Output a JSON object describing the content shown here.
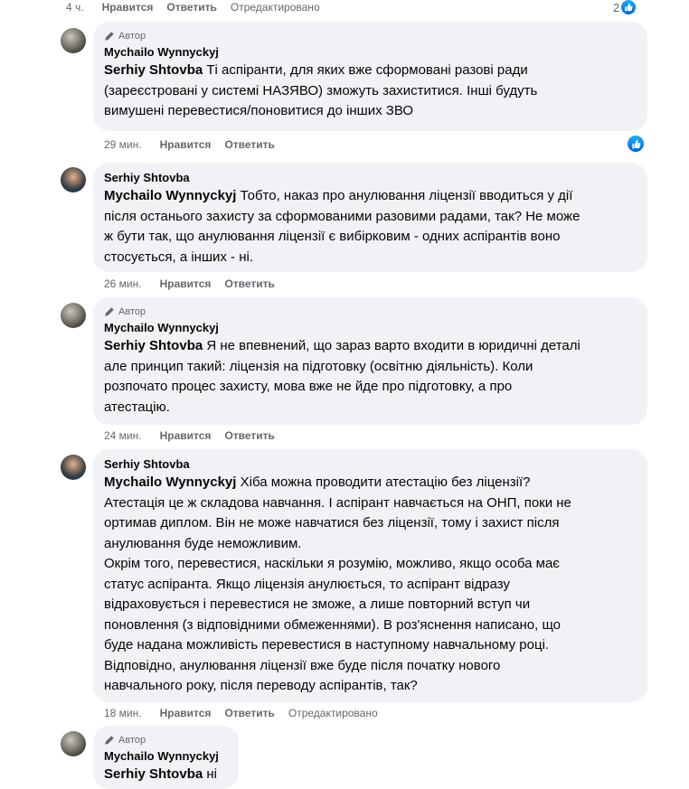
{
  "top_meta": {
    "time": "4 ч.",
    "like": "Нравится",
    "reply": "Ответить",
    "edited": "Отредактировано",
    "reactions": "2"
  },
  "comments": [
    {
      "badge": "Автор",
      "author": "Mychailo Wynnyckyj",
      "mention": "Serhiy Shtovba",
      "text": " Ті аспіранти, для яких вже сформовані разові ради\n(зареєстровані у системі НАЗЯВО) зможуть захиститися. Інші будуть\nвимушені перевестися/поновитися до інших ЗВО",
      "time": "29 мин.",
      "like": "Нравится",
      "reply": "Ответить"
    },
    {
      "author": "Serhiy Shtovba",
      "mention": "Mychailo Wynnyckyj",
      "text": " Тобто, наказ про анулювання ліцензії вводиться у дії\nпісля останього захисту за сформованими разовими радами, так? Не може\nж бути так, що анулювання ліцензії є вибірковим - одних аспірантів воно\nстосується, а інших - ні.",
      "time": "26 мин.",
      "like": "Нравится",
      "reply": "Ответить"
    },
    {
      "badge": "Автор",
      "author": "Mychailo Wynnyckyj",
      "mention": "Serhiy Shtovba",
      "text": " Я не впевнений, що зараз варто входити в юридичні деталі\nале принцип такий: ліцензія на підготовку (освітню діяльність). Коли\nрозпочато процес захисту, мова вже не йде про підготовку, а про\nатестацію.",
      "time": "24 мин.",
      "like": "Нравится",
      "reply": "Ответить"
    },
    {
      "author": "Serhiy Shtovba",
      "mention": "Mychailo Wynnyckyj",
      "text": " Хіба можна проводити атестацію без ліцензії?\nАтестація це ж складова навчання. І аспірант навчається на ОНП, поки не\nортимав диплом. Він не може навчатися без ліцензії, тому і захист після\nанулювання буде неможливим.\nОкрім того, перевестися, наскільки я розумію, можливо, якщо особа має\nстатус аспіранта. Якщо ліцензія анулюється, то аспірант відразу\nвідраховується і перевестися не зможе, а лише повторний вступ чи\nпоновлення (з відповідними обмеженнями). В роз'яснення написано, що\nбуде надана можливість перевестися в наступному навчальному році.\nВідповідно, анулювання ліцензії вже буде після початку нового\nнавчального року, після переводу аспірантів, так?",
      "time": "18 мин.",
      "like": "Нравится",
      "reply": "Ответить",
      "edited": "Отредактировано"
    },
    {
      "badge": "Автор",
      "author": "Mychailo Wynnyckyj",
      "mention": "Serhiy Shtovba",
      "text": " ні"
    }
  ],
  "colors": {
    "bubble": "#f0f2f5",
    "meta": "#65676b",
    "like_blue": "#0866ff"
  },
  "icons": {
    "badge": "pencil-icon",
    "reaction": "thumbs-up-icon"
  }
}
